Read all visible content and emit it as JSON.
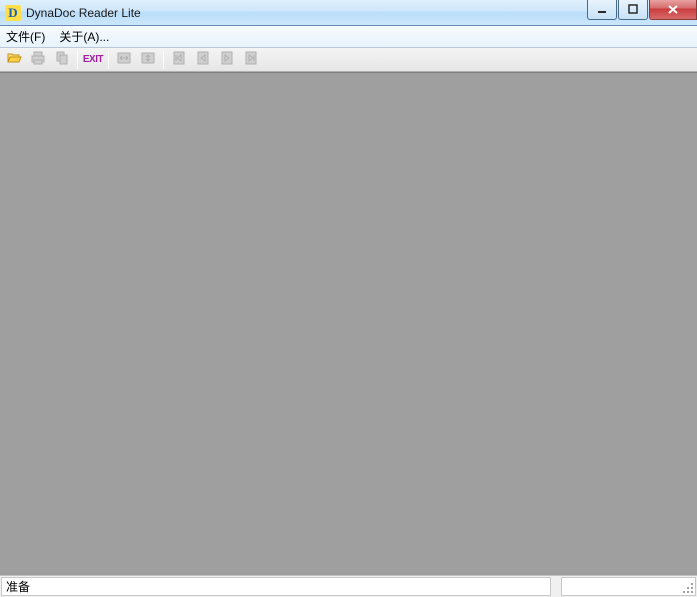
{
  "window": {
    "title": "DynaDoc Reader Lite",
    "icon_letter": "D"
  },
  "menu": {
    "file": "文件(F)",
    "about": "关于(A)..."
  },
  "toolbar": {
    "open": "open-file",
    "print": "print",
    "copy": "copy",
    "exit_label": "EXIT",
    "fit_width": "fit-width",
    "fit_page": "fit-page",
    "first_page": "first-page",
    "prev_page": "prev-page",
    "next_page": "next-page",
    "last_page": "last-page"
  },
  "status": {
    "ready": "准备"
  }
}
